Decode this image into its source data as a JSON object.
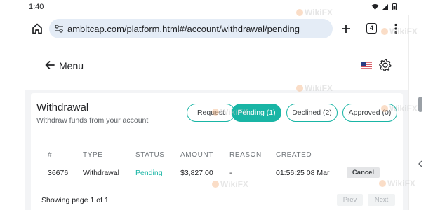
{
  "status_bar": {
    "time": "1:40"
  },
  "browser": {
    "url": "ambitcap.com/platform.html#/account/withdrawal/pending",
    "tab_count": "4"
  },
  "header": {
    "menu_label": "Menu"
  },
  "card": {
    "title": "Withdrawal",
    "subtitle": "Withdraw funds from your account",
    "filters": [
      {
        "label": "Request"
      },
      {
        "label": "Pending (1)",
        "active": true
      },
      {
        "label": "Declined (2)"
      },
      {
        "label": "Approved (0)"
      }
    ]
  },
  "table": {
    "columns": [
      "#",
      "TYPE",
      "STATUS",
      "AMOUNT",
      "REASON",
      "CREATED"
    ],
    "rows": [
      {
        "id": "36676",
        "type": "Withdrawal",
        "status": "Pending",
        "amount": "$3,827.00",
        "reason": "-",
        "created": "01:56:25 08 Mar",
        "action": "Cancel"
      }
    ]
  },
  "pagination": {
    "summary": "Showing page 1 of 1",
    "prev_label": "Prev",
    "next_label": "Next"
  },
  "watermark": {
    "text": "WikiFX"
  },
  "colors": {
    "accent": "#19b5a5",
    "omnibox": "#e4ecf6"
  }
}
